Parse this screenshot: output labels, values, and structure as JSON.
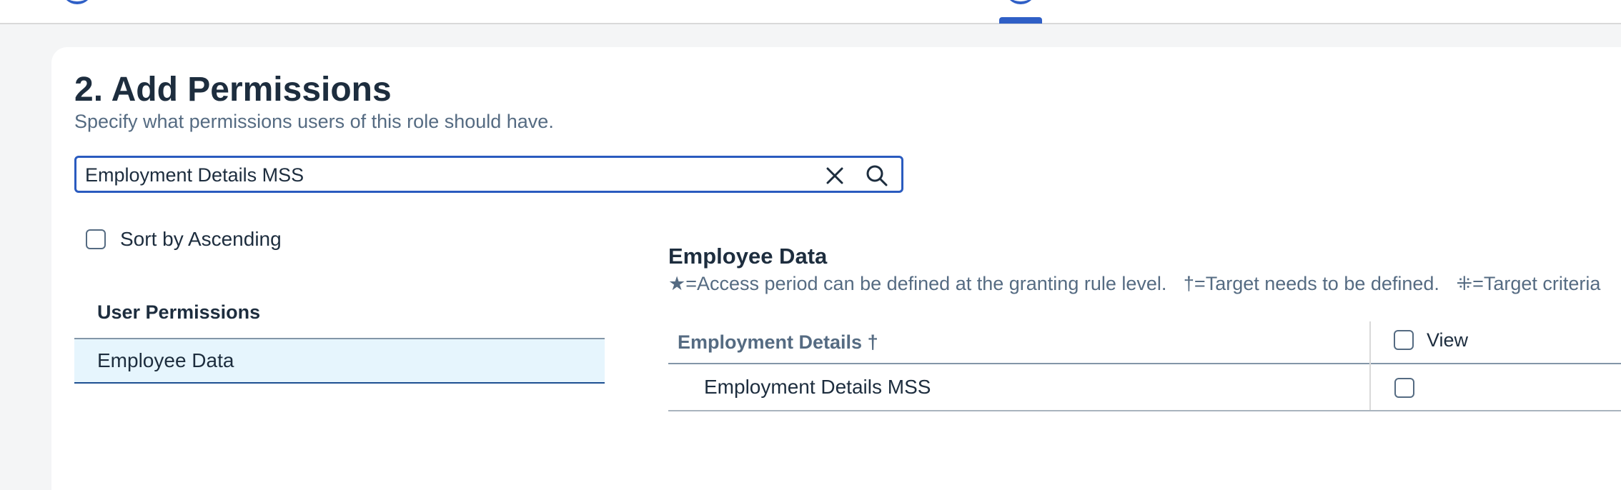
{
  "page": {
    "title": "2. Add Permissions",
    "subtitle": "Specify what permissions users of this role should have."
  },
  "search": {
    "value": "Employment Details MSS",
    "clear_icon": "close-icon",
    "search_icon": "search-icon"
  },
  "sort": {
    "label": "Sort by Ascending",
    "checked": false
  },
  "user_permissions": {
    "header": "User Permissions",
    "items": [
      {
        "label": "Employee Data",
        "selected": true
      }
    ]
  },
  "section": {
    "title": "Employee Data",
    "legend": [
      "★=Access period can be defined at the granting rule level.",
      "†=Target needs to be defined.",
      "⁜=Target criteria"
    ]
  },
  "table": {
    "group_header": "Employment Details †",
    "column_header": "View",
    "rows": [
      {
        "label": "Employment Details MSS",
        "view": false
      }
    ]
  },
  "colors": {
    "accent": "#2a5bbf",
    "selected_bg": "#e6f5fd",
    "text": "#1d2d3e",
    "muted_text": "#556b82"
  }
}
